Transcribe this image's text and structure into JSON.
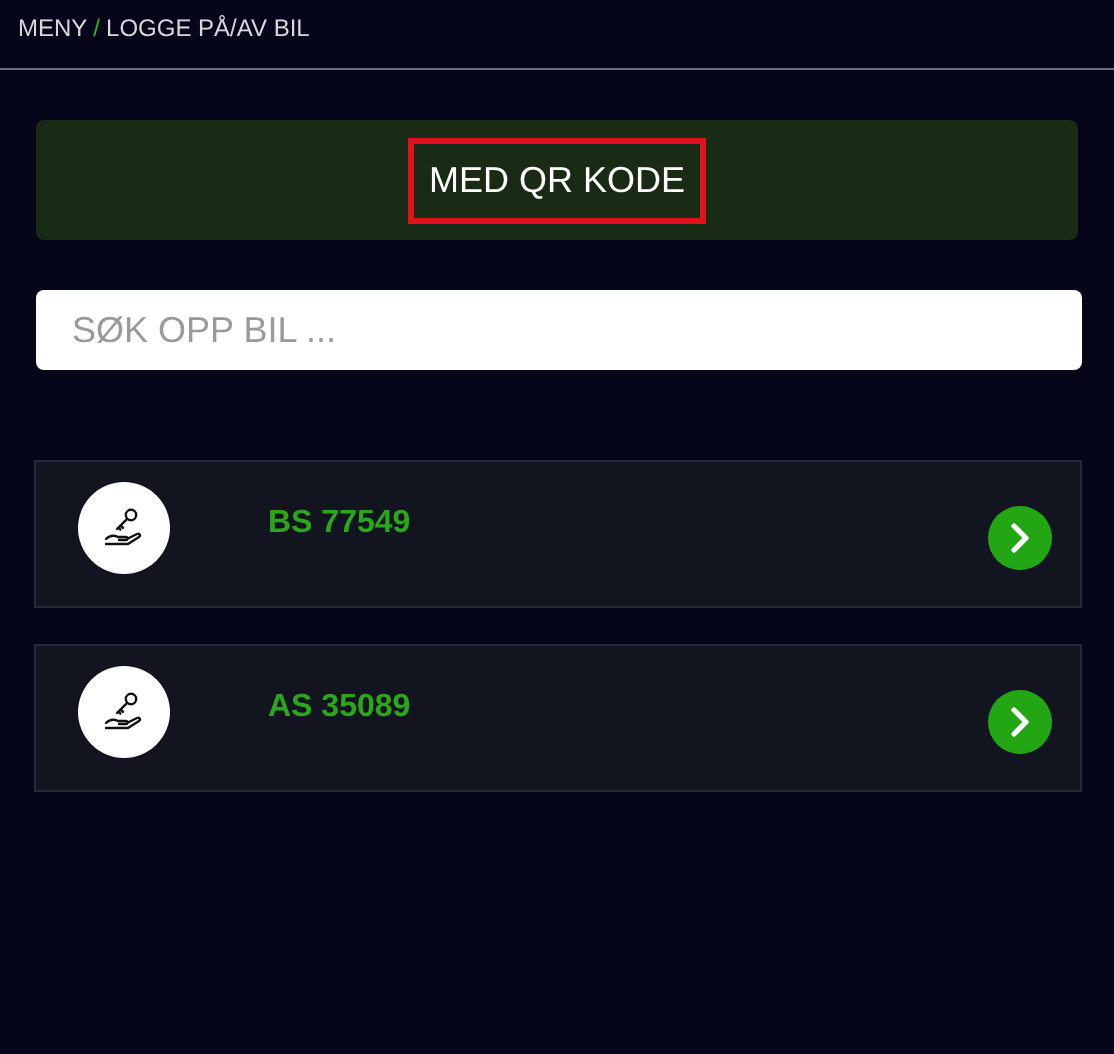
{
  "breadcrumb": [
    {
      "label": "MENY"
    },
    {
      "label": "LOGGE PÅ/AV BIL"
    }
  ],
  "separator": "/",
  "qr_button": {
    "label": "MED QR KODE",
    "highlighted": true
  },
  "search": {
    "placeholder": "SØK OPP BIL ..."
  },
  "cars": [
    {
      "plate": "BS 77549"
    },
    {
      "plate": "AS 35089"
    }
  ]
}
